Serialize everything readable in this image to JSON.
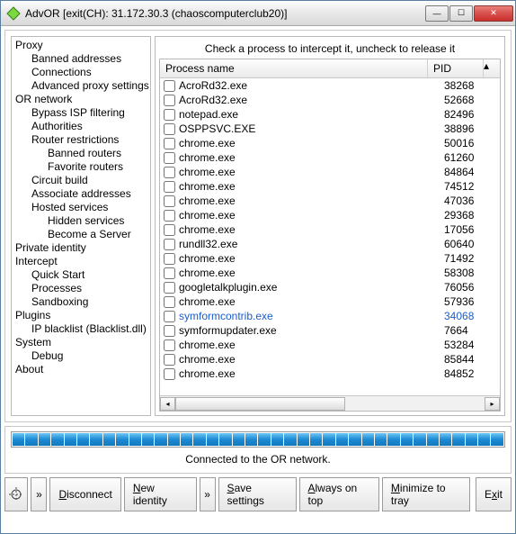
{
  "window": {
    "title": "AdvOR [exit(CH): 31.172.30.3 (chaoscomputerclub20)]"
  },
  "sidebar": {
    "items": [
      {
        "label": "Proxy",
        "indent": 0
      },
      {
        "label": "Banned addresses",
        "indent": 1
      },
      {
        "label": "Connections",
        "indent": 1
      },
      {
        "label": "Advanced proxy settings",
        "indent": 1
      },
      {
        "label": "OR network",
        "indent": 0
      },
      {
        "label": "Bypass ISP filtering",
        "indent": 1
      },
      {
        "label": "Authorities",
        "indent": 1
      },
      {
        "label": "Router restrictions",
        "indent": 1
      },
      {
        "label": "Banned routers",
        "indent": 2
      },
      {
        "label": "Favorite routers",
        "indent": 2
      },
      {
        "label": "Circuit build",
        "indent": 1
      },
      {
        "label": "Associate addresses",
        "indent": 1
      },
      {
        "label": "Hosted services",
        "indent": 1
      },
      {
        "label": "Hidden services",
        "indent": 2
      },
      {
        "label": "Become a Server",
        "indent": 2
      },
      {
        "label": "Private identity",
        "indent": 0
      },
      {
        "label": "Intercept",
        "indent": 0
      },
      {
        "label": "Quick Start",
        "indent": 1
      },
      {
        "label": "Processes",
        "indent": 1
      },
      {
        "label": "Sandboxing",
        "indent": 1
      },
      {
        "label": "Plugins",
        "indent": 0
      },
      {
        "label": "IP blacklist (Blacklist.dll)",
        "indent": 1
      },
      {
        "label": "System",
        "indent": 0
      },
      {
        "label": "Debug",
        "indent": 1
      },
      {
        "label": "About",
        "indent": 0
      }
    ]
  },
  "main": {
    "instruction": "Check a process to intercept it, uncheck to release it",
    "columns": {
      "name": "Process name",
      "pid": "PID"
    },
    "processes": [
      {
        "name": "AcroRd32.exe",
        "pid": "38268",
        "hl": false
      },
      {
        "name": "AcroRd32.exe",
        "pid": "52668",
        "hl": false
      },
      {
        "name": "notepad.exe",
        "pid": "82496",
        "hl": false
      },
      {
        "name": "OSPPSVC.EXE",
        "pid": "38896",
        "hl": false
      },
      {
        "name": "chrome.exe",
        "pid": "50016",
        "hl": false
      },
      {
        "name": "chrome.exe",
        "pid": "61260",
        "hl": false
      },
      {
        "name": "chrome.exe",
        "pid": "84864",
        "hl": false
      },
      {
        "name": "chrome.exe",
        "pid": "74512",
        "hl": false
      },
      {
        "name": "chrome.exe",
        "pid": "47036",
        "hl": false
      },
      {
        "name": "chrome.exe",
        "pid": "29368",
        "hl": false
      },
      {
        "name": "chrome.exe",
        "pid": "17056",
        "hl": false
      },
      {
        "name": "rundll32.exe",
        "pid": "60640",
        "hl": false
      },
      {
        "name": "chrome.exe",
        "pid": "71492",
        "hl": false
      },
      {
        "name": "chrome.exe",
        "pid": "58308",
        "hl": false
      },
      {
        "name": "googletalkplugin.exe",
        "pid": "76056",
        "hl": false
      },
      {
        "name": "chrome.exe",
        "pid": "57936",
        "hl": false
      },
      {
        "name": "symformcontrib.exe",
        "pid": "34068",
        "hl": true
      },
      {
        "name": "symformupdater.exe",
        "pid": "7664",
        "hl": false
      },
      {
        "name": "chrome.exe",
        "pid": "53284",
        "hl": false
      },
      {
        "name": "chrome.exe",
        "pid": "85844",
        "hl": false
      },
      {
        "name": "chrome.exe",
        "pid": "84852",
        "hl": false
      }
    ]
  },
  "status": {
    "text": "Connected to the OR network."
  },
  "buttons": {
    "disconnect": "Disconnect",
    "new_identity": "New identity",
    "save": "Save settings",
    "always_on_top": "Always on top",
    "minimize_tray": "Minimize to tray",
    "exit": "Exit",
    "chevron": "»"
  },
  "colors": {
    "highlight": "#1a5bcf",
    "close_btn": "#c9302c",
    "progress": "#1e8bd4"
  }
}
